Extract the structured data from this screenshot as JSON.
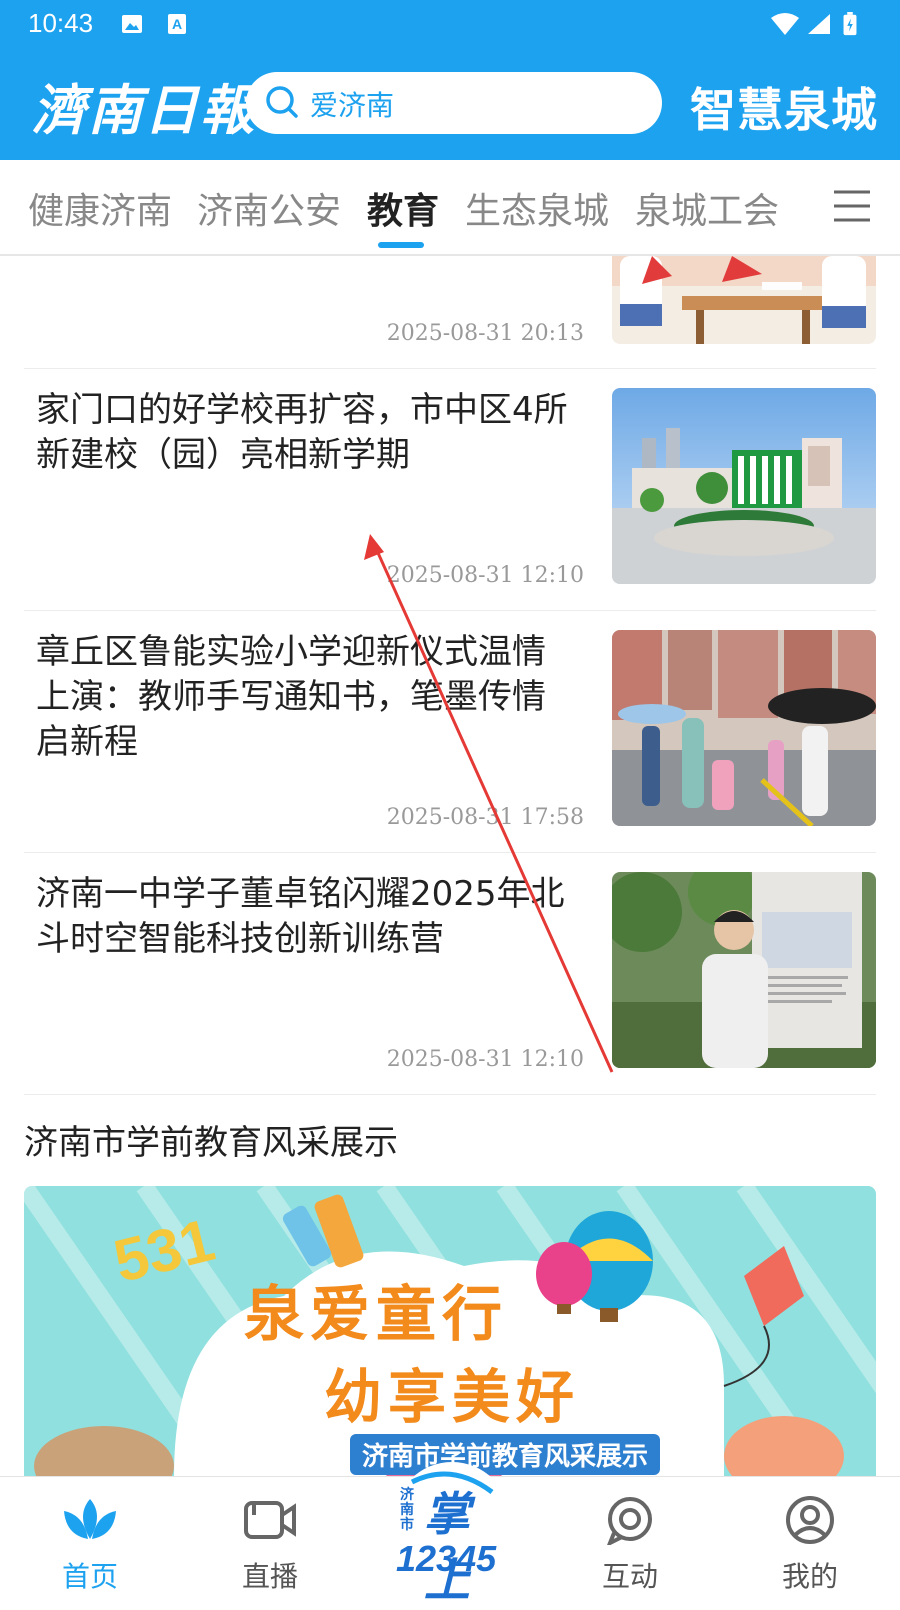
{
  "status_bar": {
    "time": "10:43"
  },
  "header": {
    "logo": "濟南日報",
    "search_placeholder": "爱济南",
    "brand": "智慧泉城"
  },
  "tabs": {
    "items": [
      "健康济南",
      "济南公安",
      "教育",
      "生态泉城",
      "泉城工会"
    ],
    "active": "教育"
  },
  "news": [
    {
      "title": "",
      "date": "2025-08-31 20:13"
    },
    {
      "title": "家门口的好学校再扩容，市中区4所新建校（园）亮相新学期",
      "date": "2025-08-31 12:10"
    },
    {
      "title": "章丘区鲁能实验小学迎新仪式温情上演：教师手写通知书，笔墨传情启新程",
      "date": "2025-08-31 17:58"
    },
    {
      "title": "济南一中学子董卓铭闪耀2025年北斗时空智能科技创新训练营",
      "date": "2025-08-31 12:10"
    }
  ],
  "section": {
    "title": "济南市学前教育风采展示"
  },
  "banner": {
    "line1": "泉爱童行",
    "line2": "幼享美好",
    "caption": "济南市学前教育风采展示",
    "numbers": "531"
  },
  "bottom_nav": {
    "home": "首页",
    "live": "直播",
    "center_line1": "济南市",
    "center_line2": "掌上",
    "center_line3": "12345",
    "interact": "互动",
    "mine": "我的"
  },
  "colors": {
    "primary": "#1da2f0",
    "annotation": "#e53935"
  }
}
